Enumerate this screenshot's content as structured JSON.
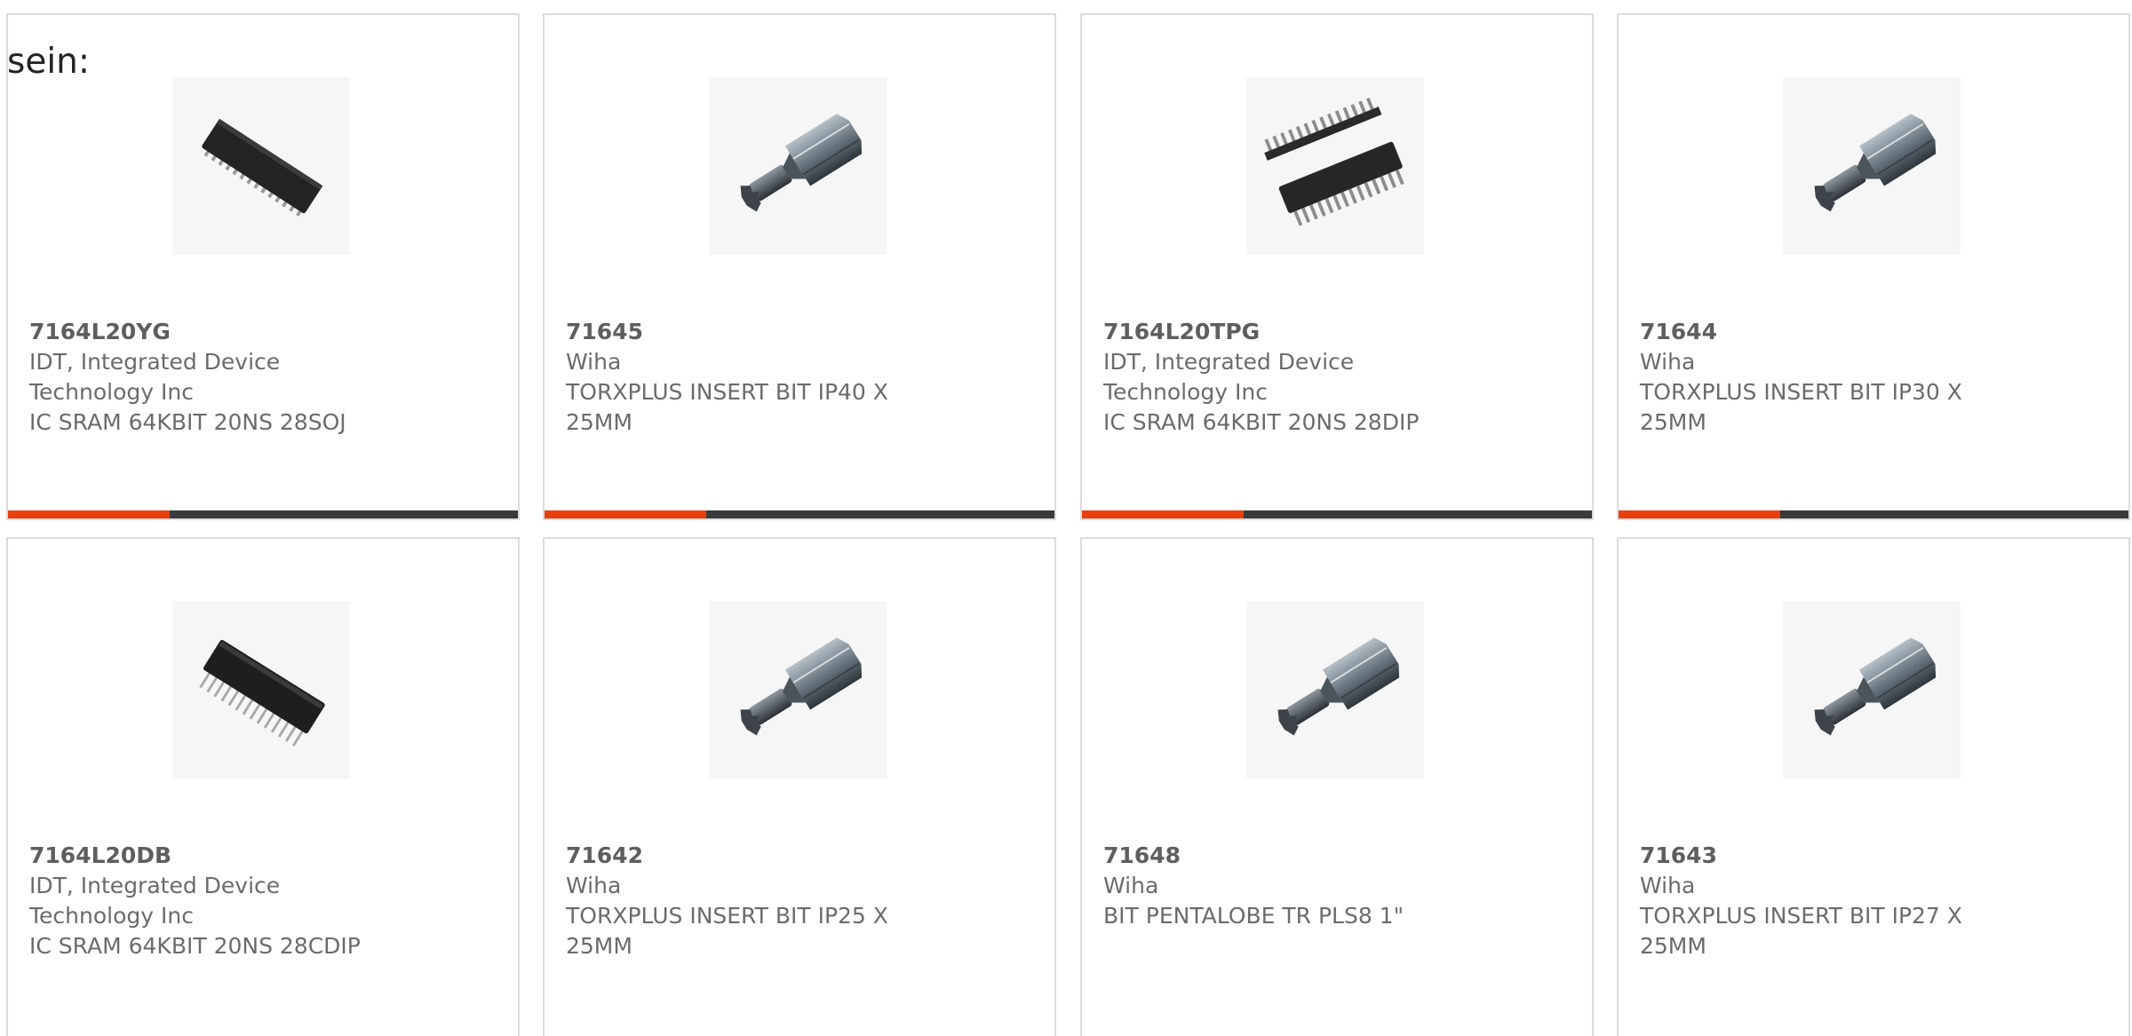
{
  "intro_text": "sein:",
  "colors": {
    "accent": "#e8400c",
    "bar": "#3a3a3a",
    "card_border": "#dcdcdc",
    "text": "#6b6b6b"
  },
  "products": [
    {
      "part_number": "7164L20YG",
      "manufacturer": "IDT, Integrated Device Technology Inc",
      "description": "IC SRAM 64KBIT 20NS 28SOJ",
      "image": "soj-chip-image"
    },
    {
      "part_number": "71645",
      "manufacturer": "Wiha",
      "description": "TORXPLUS INSERT BIT IP40 X 25MM",
      "image": "screwdriver-bit-image"
    },
    {
      "part_number": "7164L20TPG",
      "manufacturer": "IDT, Integrated Device Technology Inc",
      "description": "IC SRAM 64KBIT 20NS 28DIP",
      "image": "dip-chip-image"
    },
    {
      "part_number": "71644",
      "manufacturer": "Wiha",
      "description": "TORXPLUS INSERT BIT IP30 X 25MM",
      "image": "screwdriver-bit-image"
    },
    {
      "part_number": "7164L20DB",
      "manufacturer": "IDT, Integrated Device Technology Inc",
      "description": "IC SRAM 64KBIT 20NS 28CDIP",
      "image": "cdip-chip-image"
    },
    {
      "part_number": "71642",
      "manufacturer": "Wiha",
      "description": "TORXPLUS INSERT BIT IP25 X 25MM",
      "image": "screwdriver-bit-image"
    },
    {
      "part_number": "71648",
      "manufacturer": "Wiha",
      "description": "BIT PENTALOBE TR PLS8 1\"",
      "image": "screwdriver-bit-image"
    },
    {
      "part_number": "71643",
      "manufacturer": "Wiha",
      "description": "TORXPLUS INSERT BIT IP27 X 25MM",
      "image": "screwdriver-bit-image"
    }
  ]
}
